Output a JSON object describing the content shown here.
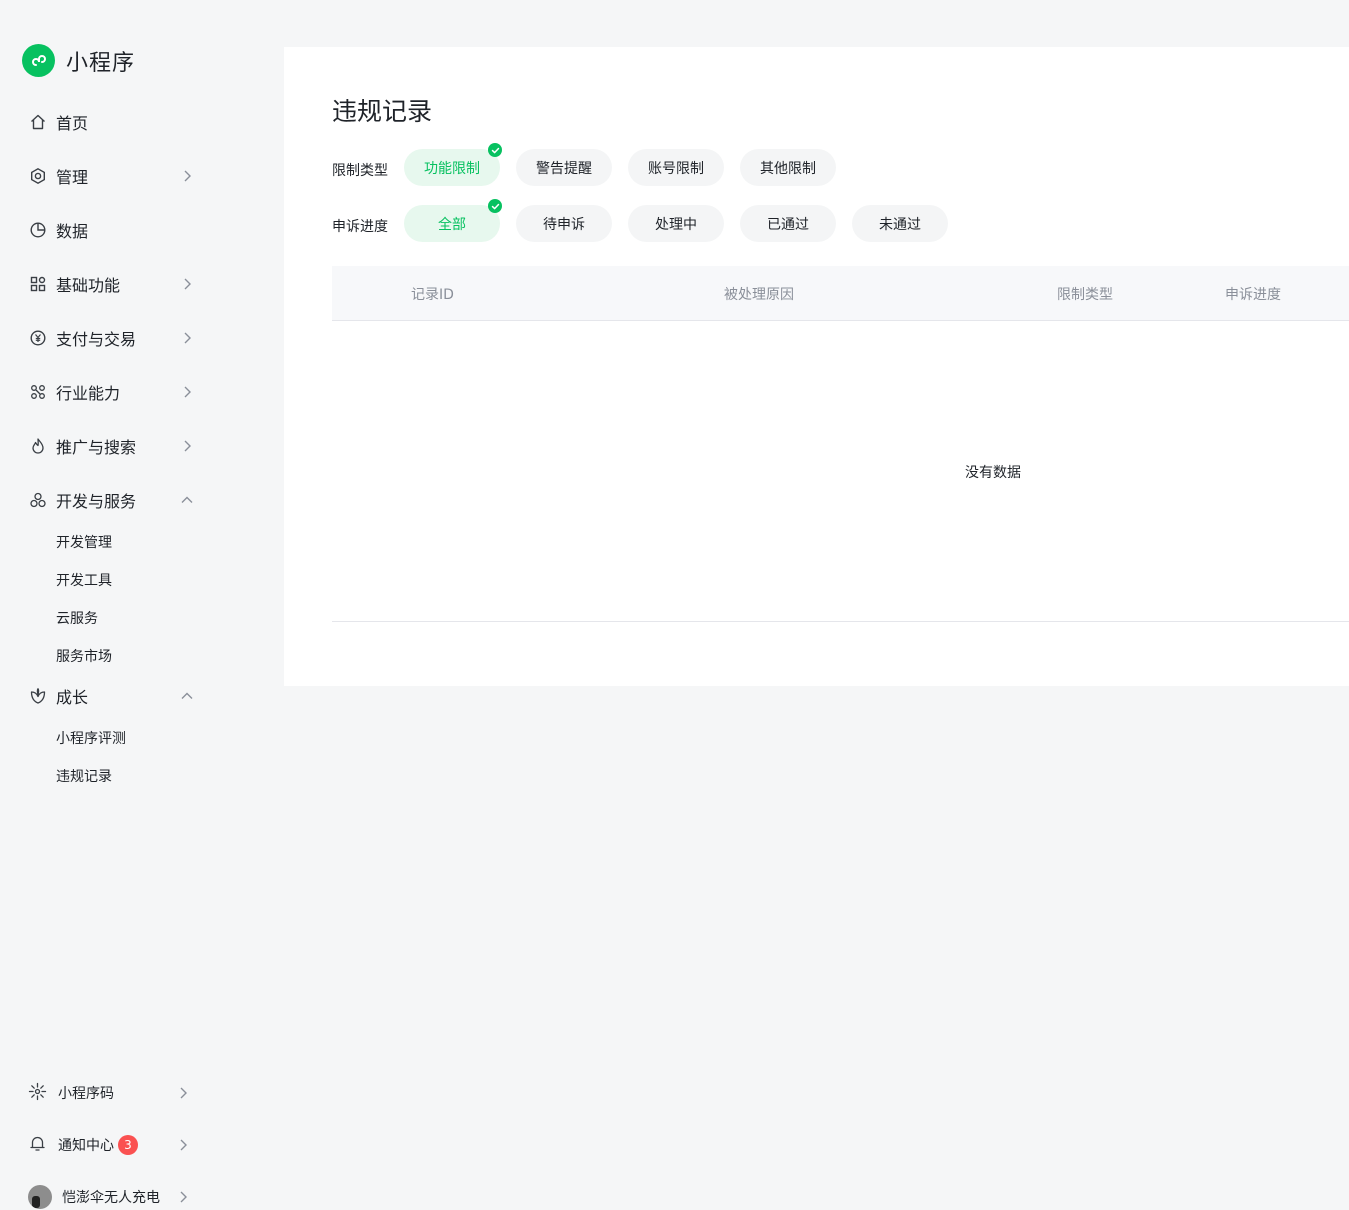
{
  "app": {
    "name": "小程序"
  },
  "sidebar": {
    "items": [
      {
        "label": "首页",
        "icon": "home-icon"
      },
      {
        "label": "管理",
        "icon": "settings-icon"
      },
      {
        "label": "数据",
        "icon": "chart-icon"
      },
      {
        "label": "基础功能",
        "icon": "grid-icon"
      },
      {
        "label": "支付与交易",
        "icon": "yuan-icon"
      },
      {
        "label": "行业能力",
        "icon": "industry-icon"
      },
      {
        "label": "推广与搜索",
        "icon": "flame-icon"
      },
      {
        "label": "开发与服务",
        "icon": "dev-icon"
      },
      {
        "label": "成长",
        "icon": "growth-icon"
      }
    ],
    "dev_sub": [
      "开发管理",
      "开发工具",
      "云服务",
      "服务市场"
    ],
    "growth_sub": [
      "小程序评测",
      "违规记录"
    ],
    "bottom": {
      "qrcode": "小程序码",
      "notifications": "通知中心",
      "notification_count": "3",
      "user": "恺澎伞无人充电"
    }
  },
  "main": {
    "title": "违规记录",
    "restriction_filter": {
      "label": "限制类型",
      "options": [
        "功能限制",
        "警告提醒",
        "账号限制",
        "其他限制"
      ],
      "selected": "功能限制"
    },
    "appeal_filter": {
      "label": "申诉进度",
      "options": [
        "全部",
        "待申诉",
        "处理中",
        "已通过",
        "未通过"
      ],
      "selected": "全部"
    },
    "table": {
      "columns": [
        "记录ID",
        "被处理原因",
        "限制类型",
        "申诉进度"
      ],
      "empty_text": "没有数据"
    }
  },
  "colors": {
    "accent": "#07c160",
    "badge": "#fa5151",
    "chip_bg": "#f4f5f6",
    "chip_active_bg": "#e7f8ee"
  }
}
